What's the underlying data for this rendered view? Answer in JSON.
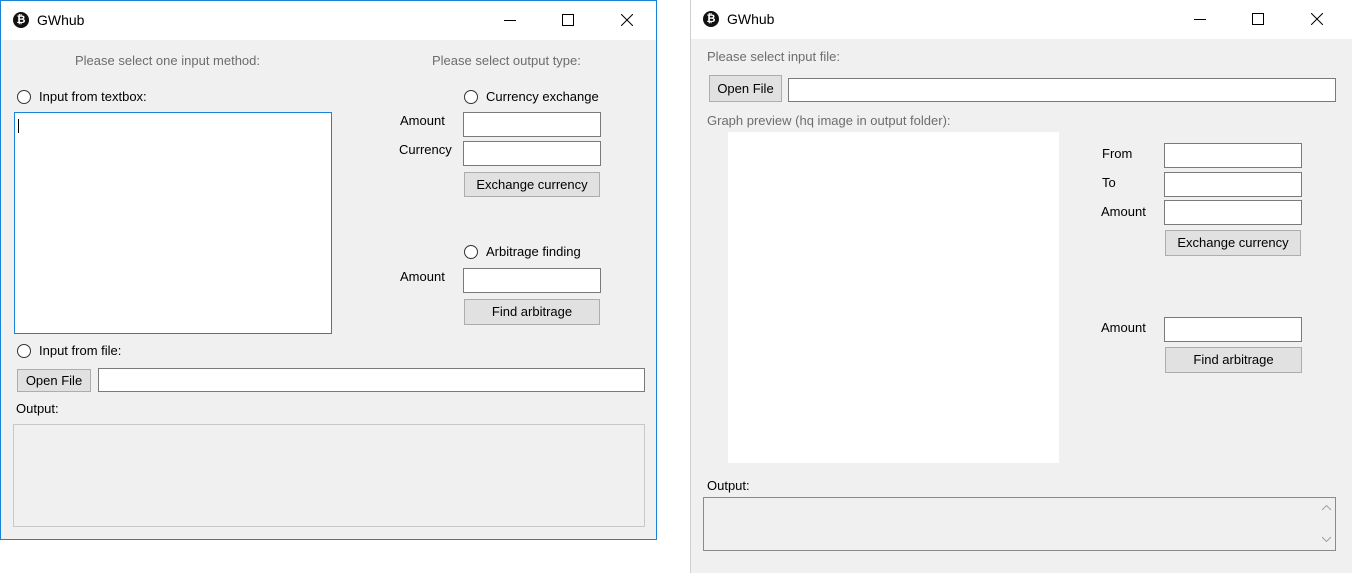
{
  "window1": {
    "title": "GWhub",
    "icon": "bitcoin-icon",
    "controls": [
      "minimize-icon",
      "maximize-icon",
      "close-icon"
    ],
    "input_method_heading": "Please select one input method:",
    "output_type_heading": "Please select output type:",
    "radio_textbox_label": "Input from textbox:",
    "textbox_value": "",
    "radio_file_label": "Input from file:",
    "open_file_label": "Open File",
    "file_path_value": "",
    "output_label": "Output:",
    "output_value": "",
    "currency_exchange": {
      "radio_label": "Currency exchange",
      "amount_label": "Amount",
      "currency_label": "Currency",
      "amount_value": "",
      "currency_value": "",
      "button_label": "Exchange currency"
    },
    "arbitrage": {
      "radio_label": "Arbitrage finding",
      "amount_label": "Amount",
      "amount_value": "",
      "button_label": "Find arbitrage"
    }
  },
  "window2": {
    "title": "GWhub",
    "icon": "bitcoin-icon",
    "controls": [
      "minimize-icon",
      "maximize-icon",
      "close-icon"
    ],
    "select_file_label": "Please select input file:",
    "open_file_label": "Open File",
    "file_path_value": "",
    "graph_preview_label": "Graph preview (hq image in output folder):",
    "exchange": {
      "from_label": "From",
      "to_label": "To",
      "amount_label": "Amount",
      "from_value": "",
      "to_value": "",
      "amount_value": "",
      "button_label": "Exchange currency"
    },
    "arbitrage": {
      "amount_label": "Amount",
      "amount_value": "",
      "button_label": "Find arbitrage"
    },
    "output_label": "Output:",
    "output_value": ""
  },
  "colors": {
    "window_bg": "#f0f0f0",
    "focus_border": "#1883d7",
    "button_bg": "#e1e1e1"
  }
}
